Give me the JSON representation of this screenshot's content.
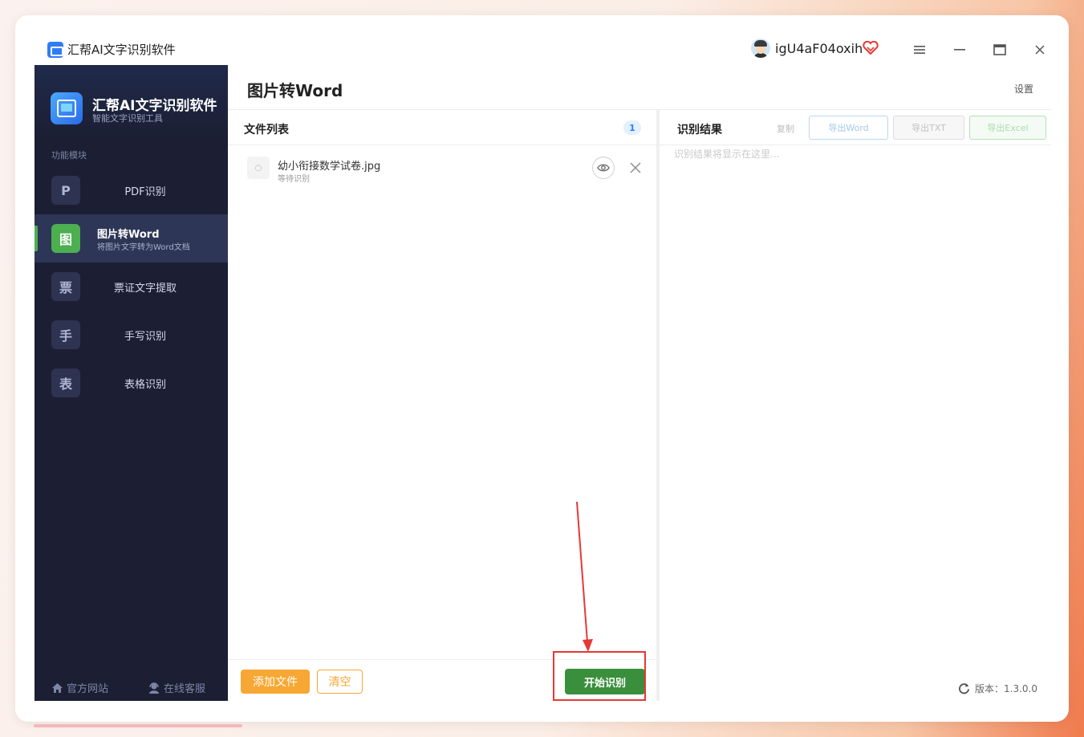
{
  "titlebar": {
    "app_title": "汇帮AI文字识别软件",
    "username": "igU4aF04oxih",
    "icons": [
      "app-icon",
      "avatar",
      "vip-heart-icon",
      "menu-icon",
      "minimize-icon",
      "maximize-icon",
      "close-icon"
    ]
  },
  "sidebar": {
    "brand_title": "汇帮AI文字识别软件",
    "brand_subtitle": "智能文字识别工具",
    "section_label": "功能模块",
    "items": [
      {
        "badge": "P",
        "label": "PDF识别"
      },
      {
        "badge": "图",
        "label": "图片转Word",
        "desc": "将图片文字转为Word文档",
        "active": true
      },
      {
        "badge": "票",
        "label": "票证文字提取"
      },
      {
        "badge": "手",
        "label": "手写识别"
      },
      {
        "badge": "表",
        "label": "表格识别"
      }
    ],
    "footer": {
      "website": "官方网站",
      "support": "在线客服"
    },
    "accent_color": "#4caf50"
  },
  "main": {
    "page_title": "图片转Word",
    "settings": "设置",
    "file_list": {
      "title": "文件列表",
      "count": "1",
      "files": [
        {
          "thumb": "○",
          "name": "幼小衔接数学试卷.jpg",
          "status": "等待识别"
        }
      ]
    },
    "actions": {
      "add_files": "添加文件",
      "clear": "清空",
      "start": "开始识别"
    },
    "result": {
      "title": "识别结果",
      "copy": "复制",
      "export_word": "导出Word",
      "export_txt": "导出TXT",
      "export_excel": "导出Excel",
      "placeholder": "识别结果将显示在这里..."
    },
    "version": "版本：1.3.0.0"
  },
  "colors": {
    "sidebar_bg": "#1c1f33",
    "orange": "#f7a733",
    "green": "#3a8f3c",
    "annotation_red": "#e53935"
  }
}
